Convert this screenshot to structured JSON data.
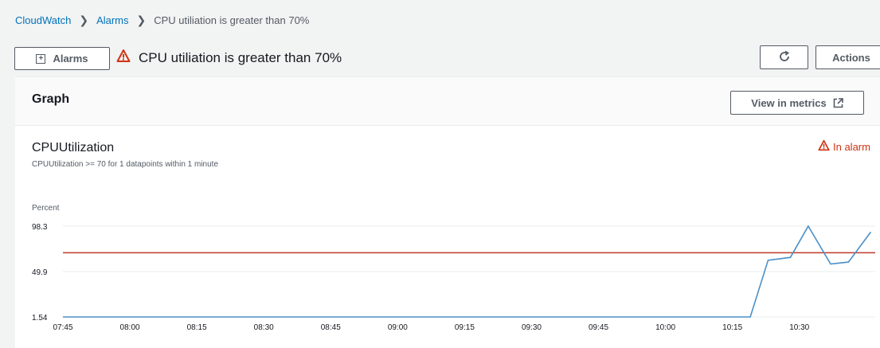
{
  "breadcrumb": {
    "items": [
      "CloudWatch",
      "Alarms",
      "CPU utiliation is greater than 70%"
    ]
  },
  "toolbar": {
    "alarms_label": "Alarms",
    "title": "CPU utiliation is greater than 70%",
    "actions_label": "Actions"
  },
  "graph": {
    "header": "Graph",
    "view_metrics_label": "View in metrics",
    "metric_title": "CPUUtilization",
    "condition": "CPUUtilization >= 70 for 1 datapoints within 1 minute",
    "state": "In alarm"
  },
  "colors": {
    "link": "#0073bb",
    "alarm": "#d13212",
    "series": "#4a90c8",
    "threshold": "#c0392b"
  },
  "chart_data": {
    "type": "line",
    "ylabel": "Percent",
    "y_ticks": [
      98.3,
      49.9,
      1.54
    ],
    "ylim": [
      1.54,
      98.3
    ],
    "x_ticks": [
      "07:45",
      "08:00",
      "08:15",
      "08:30",
      "08:45",
      "09:00",
      "09:15",
      "09:30",
      "09:45",
      "10:00",
      "10:15",
      "10:30"
    ],
    "x_domain_minutes": [
      463,
      645
    ],
    "threshold": 70,
    "series": [
      {
        "points": [
          [
            463,
            1.54
          ],
          [
            617,
            1.54
          ],
          [
            621,
            62
          ],
          [
            626,
            65
          ],
          [
            630,
            98.3
          ],
          [
            635,
            58
          ],
          [
            639,
            60
          ],
          [
            644,
            92
          ]
        ]
      }
    ],
    "grid": true
  }
}
